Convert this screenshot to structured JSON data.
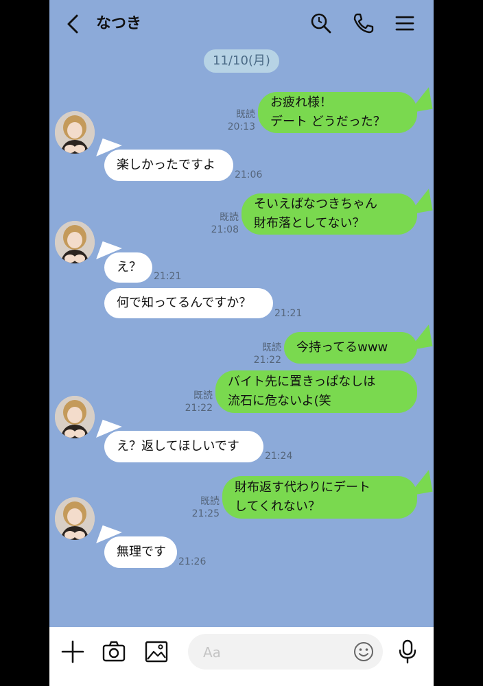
{
  "header": {
    "title": "なつき"
  },
  "date_separator": "11/10(月)",
  "messages": [
    {
      "dir": "out",
      "lines": "お疲れ様！\nデート どうだった？",
      "read": "既読",
      "time": "20:13"
    },
    {
      "dir": "in",
      "text": "楽しかったですよ",
      "time": "21:06"
    },
    {
      "dir": "out",
      "lines": "そいえばなつきちゃん\n財布落としてない？",
      "read": "既読",
      "time": "21:08"
    },
    {
      "dir": "in",
      "text": "え？",
      "time": "21:21"
    },
    {
      "dir": "in",
      "text": "何で知ってるんですか？",
      "time": "21:21"
    },
    {
      "dir": "out",
      "text": "今持ってるwww",
      "read": "既読",
      "time": "21:22"
    },
    {
      "dir": "out",
      "lines": "バイト先に置きっぱなしは\n流石に危ないよ(笑",
      "read": "既読",
      "time": "21:22"
    },
    {
      "dir": "in",
      "text": "え？返してほしいです",
      "time": "21:24"
    },
    {
      "dir": "out",
      "lines": "財布返す代わりにデート\nしてくれない？",
      "read": "既読",
      "time": "21:25"
    },
    {
      "dir": "in",
      "text": "無理です",
      "time": "21:26"
    }
  ],
  "footer": {
    "input_placeholder": "Aa"
  },
  "colors": {
    "background": "#8caad9",
    "outgoing_bubble": "#7ad94f",
    "incoming_bubble": "#ffffff",
    "date_pill": "#b7d3e5"
  },
  "icons": [
    "back-icon",
    "search-icon",
    "phone-icon",
    "menu-icon",
    "plus-icon",
    "camera-icon",
    "image-icon",
    "emoji-icon",
    "mic-icon"
  ]
}
